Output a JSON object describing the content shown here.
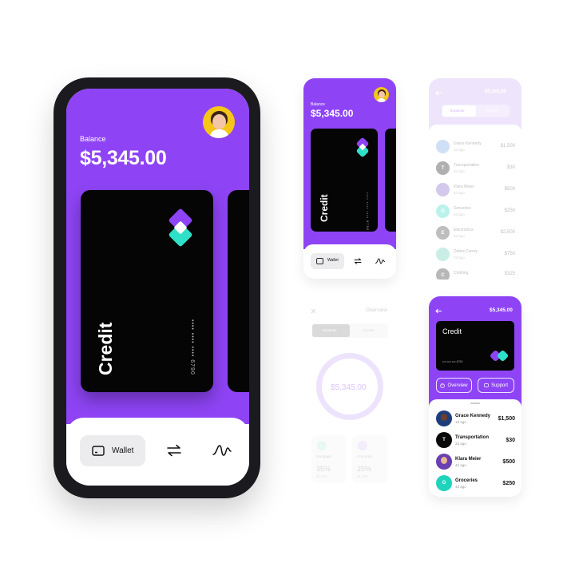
{
  "colors": {
    "accent": "#8e44f5",
    "teal": "#2fe0c8",
    "card": "#050505"
  },
  "main_phone": {
    "balance_label": "Balance",
    "balance_value": "$5,345.00",
    "card_label": "Credit",
    "card_number": "•••• •••• •••• 6790",
    "nav": {
      "wallet_label": "Wallet",
      "transfer_icon": "arrows-exchange-icon",
      "stats_icon": "wave-chart-icon"
    }
  },
  "small_phone": {
    "balance_label": "Balance",
    "balance_value": "$5,345.00",
    "card_label": "Credit",
    "card_number": "•••• •••• •••• 6790",
    "nav": {
      "wallet_label": "Wallet"
    }
  },
  "transactions_screen": {
    "balance": "$5,345.00",
    "tabs": [
      "Expense",
      "Income"
    ],
    "items": [
      {
        "initial": "",
        "name": "Grace Kennedy",
        "sub": "1d ago",
        "amount": "$1,500"
      },
      {
        "initial": "T",
        "name": "Transportation",
        "sub": "2d ago",
        "amount": "$30"
      },
      {
        "initial": "",
        "name": "Klara Meier",
        "sub": "4d ago",
        "amount": "$500"
      },
      {
        "initial": "G",
        "name": "Groceries",
        "sub": "4d ago",
        "amount": "$250"
      },
      {
        "initial": "E",
        "name": "Electronics",
        "sub": "6d ago",
        "amount": "$2,500"
      },
      {
        "initial": "",
        "name": "Debra Currey",
        "sub": "7d ago",
        "amount": "$750"
      },
      {
        "initial": "C",
        "name": "Clothing",
        "sub": "8d ago",
        "amount": "$325"
      }
    ]
  },
  "overview_screen": {
    "title": "Overview",
    "tabs": [
      "Expense",
      "Income"
    ],
    "total": "$5,345.00",
    "stats": [
      {
        "label": "Mortgage",
        "percent": "35%",
        "amount": "$1,870"
      },
      {
        "label": "Groceries",
        "percent": "25%",
        "amount": "$1,336"
      }
    ]
  },
  "detail_screen": {
    "balance": "$5,345.00",
    "card_label": "Credit",
    "card_number": "•••• •••• •••• 6790",
    "buttons": {
      "overview": "Overview",
      "support": "Support"
    },
    "items": [
      {
        "initial": "",
        "name": "Grace Kennedy",
        "sub": "1d ago",
        "amount": "$1,500",
        "color": "#1f3d7a"
      },
      {
        "initial": "T",
        "name": "Transportation",
        "sub": "2d ago",
        "amount": "$30",
        "color": "#0a0a0a"
      },
      {
        "initial": "",
        "name": "Klara Meier",
        "sub": "4d ago",
        "amount": "$500",
        "color": "#6a3fb0"
      },
      {
        "initial": "G",
        "name": "Groceries",
        "sub": "4d ago",
        "amount": "$250",
        "color": "#1fd4bd"
      }
    ]
  }
}
